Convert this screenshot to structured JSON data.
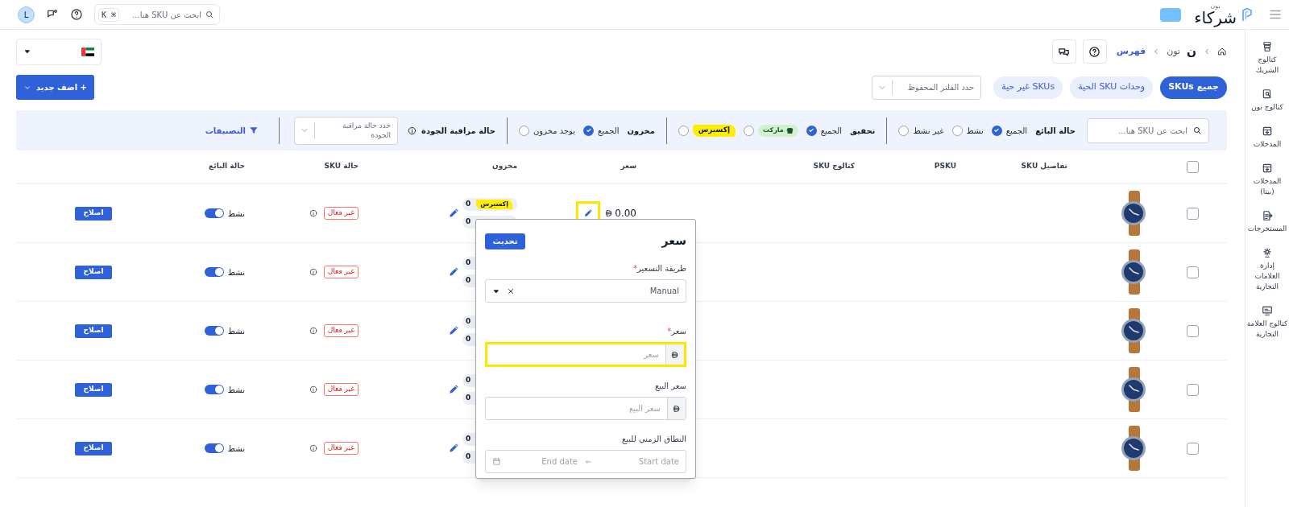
{
  "top_bar": {
    "logo": {
      "name": "شركاء",
      "caption": "نون"
    },
    "search": {
      "placeholder": "ابحث عن SKU هنا...",
      "shortcut": "⌘ K"
    },
    "avatar": "L"
  },
  "sidebar": {
    "items": [
      {
        "label": "كتالوج الشريك"
      },
      {
        "label": "كتالوج نون"
      },
      {
        "label": "المدخلات"
      },
      {
        "label": "المدخلات (بيتا)"
      },
      {
        "label": "المستخرجات"
      },
      {
        "label": "إدارة العلامات التجارية"
      },
      {
        "label": "كتالوج العلامة التجارية"
      }
    ]
  },
  "breadcrumb": [
    {
      "kind": "home"
    },
    {
      "kind": "link",
      "mark": "ن",
      "label": "نون",
      "current": false
    },
    {
      "kind": "link",
      "label": "فهرس",
      "current": true
    }
  ],
  "tabs": [
    {
      "label": "جميع SKUs",
      "selected": true
    },
    {
      "label": "وحدات SKU الحية",
      "selected": false
    },
    {
      "label": "SKUs غير حية",
      "selected": false
    }
  ],
  "saved_filter": {
    "placeholder": "حدد الفلتر المحفوظ"
  },
  "add_button": "+ اضف جديد",
  "filters": {
    "search": {
      "placeholder": "ابحث عن SKU هنا..."
    },
    "groups": [
      {
        "label": "حالة البائع",
        "options": [
          {
            "kind": "text",
            "label": "الجميع",
            "selected": true
          },
          {
            "kind": "text",
            "label": "نشط",
            "selected": false
          },
          {
            "kind": "text",
            "label": "غير نشط",
            "selected": false
          }
        ]
      },
      {
        "label": "تحقيق",
        "options": [
          {
            "kind": "text",
            "label": "الجميع",
            "selected": true
          },
          {
            "kind": "market",
            "label": "ماركت",
            "selected": false
          },
          {
            "kind": "express",
            "label": "إكسبرس",
            "selected": false
          }
        ]
      },
      {
        "label": "مخزون",
        "options": [
          {
            "kind": "text",
            "label": "الجميع",
            "selected": true
          },
          {
            "kind": "text",
            "label": "يوجد مخزون",
            "selected": false
          }
        ]
      }
    ],
    "qc": {
      "label": "حالة مراقبة الجودة",
      "placeholder": "حدد حالة مراقبة الجودة"
    },
    "categories": "التصنيفات"
  },
  "table": {
    "select_all": false,
    "columns": [
      "تفاصيل SKU",
      "PSKU",
      "كتالوج SKU",
      "سعر",
      "مخزون",
      "حالة SKU",
      "حالة البائع"
    ],
    "rows": [
      {
        "checked": false,
        "price": "0.00",
        "price_edit_highlighted": true,
        "stock": [
          {
            "kind": "express",
            "label": "إكسبرس",
            "count": "0"
          },
          {
            "count": "0"
          }
        ],
        "sku_status": "غير فعال",
        "seller_active": true,
        "seller_status": "نشط",
        "action": "اصلاح"
      },
      {
        "checked": false,
        "stock": [
          {
            "count": "0"
          },
          {
            "count": "0"
          }
        ],
        "sku_status": "غير فعال",
        "seller_active": true,
        "seller_status": "نشط",
        "action": "اصلاح"
      },
      {
        "checked": false,
        "stock": [
          {
            "count": "0"
          },
          {
            "count": "0"
          }
        ],
        "sku_status": "غير فعال",
        "seller_active": true,
        "seller_status": "نشط",
        "action": "اصلاح"
      },
      {
        "checked": false,
        "stock": [
          {
            "count": "0"
          },
          {
            "count": "0"
          }
        ],
        "sku_status": "غير فعال",
        "seller_active": true,
        "seller_status": "نشط",
        "action": "اصلاح"
      },
      {
        "checked": false,
        "stock": [
          {
            "count": "0"
          },
          {
            "count": "0"
          }
        ],
        "sku_status": "غير فعال",
        "seller_active": true,
        "seller_status": "نشط",
        "action": "اصلاح"
      }
    ]
  },
  "price_popup": {
    "title": "سعر",
    "button": "تحديث",
    "fields": [
      {
        "kind": "select",
        "label": "طريقة التسعير",
        "required_mark": "*",
        "value": "Manual"
      },
      {
        "kind": "currency",
        "label": "سعر",
        "required_mark": "*",
        "placeholder": "سعر",
        "highlighted": true
      },
      {
        "kind": "currency",
        "label": "سعر البيع",
        "placeholder": "سعر البيع",
        "highlighted": false
      },
      {
        "kind": "date-range",
        "label": "النطاق الزمني للبيع",
        "start_placeholder": "Start date",
        "end_placeholder": "End date"
      }
    ]
  }
}
